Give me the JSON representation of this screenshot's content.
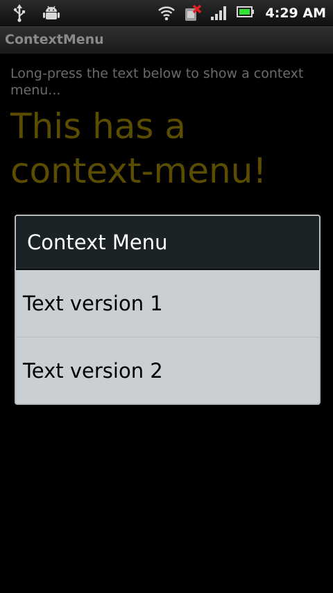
{
  "status_bar": {
    "time": "4:29 AM",
    "icons": [
      "usb-icon",
      "android-debug-icon",
      "wifi-icon",
      "sim-error-icon",
      "signal-icon",
      "battery-icon"
    ]
  },
  "app": {
    "title": "ContextMenu"
  },
  "content": {
    "hint": "Long-press the text below to show a context menu...",
    "big_text": "This has a context-menu!"
  },
  "dialog": {
    "title": "Context Menu",
    "items": [
      {
        "label": "Text version 1"
      },
      {
        "label": "Text version 2"
      }
    ]
  },
  "colors": {
    "background": "#000000",
    "hint_text": "#6b6b6b",
    "big_text": "#5b4d00",
    "dialog_header": "#1c2326",
    "dialog_body": "#c9cfd2"
  }
}
